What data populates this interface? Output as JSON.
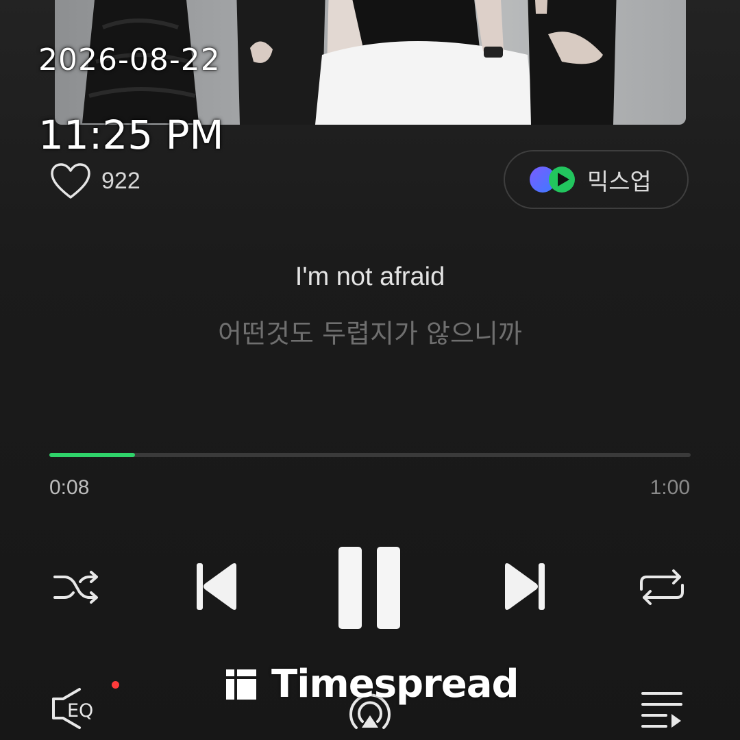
{
  "overlay": {
    "date": "2026-08-22",
    "time": "11:25 PM"
  },
  "like": {
    "count": "922",
    "icon": "heart-outline-icon"
  },
  "mixup": {
    "label": "믹스업",
    "icon": "mixup-logo-icon"
  },
  "lyrics": {
    "current_line": "I'm not afraid",
    "translation": "어떤것도 두렵지가 않으니까"
  },
  "playback": {
    "elapsed": "0:08",
    "duration": "1:00",
    "progress_fraction": 0.1333,
    "accent_color": "#2fd36a"
  },
  "controls": {
    "shuffle_icon": "shuffle-icon",
    "prev_icon": "skip-previous-icon",
    "pause_icon": "pause-icon",
    "next_icon": "skip-next-icon",
    "repeat_icon": "repeat-icon",
    "eq_label": "EQ",
    "cast_icon": "cast-icon",
    "playlist_icon": "playlist-icon"
  },
  "watermark": {
    "text": "Timespread"
  }
}
